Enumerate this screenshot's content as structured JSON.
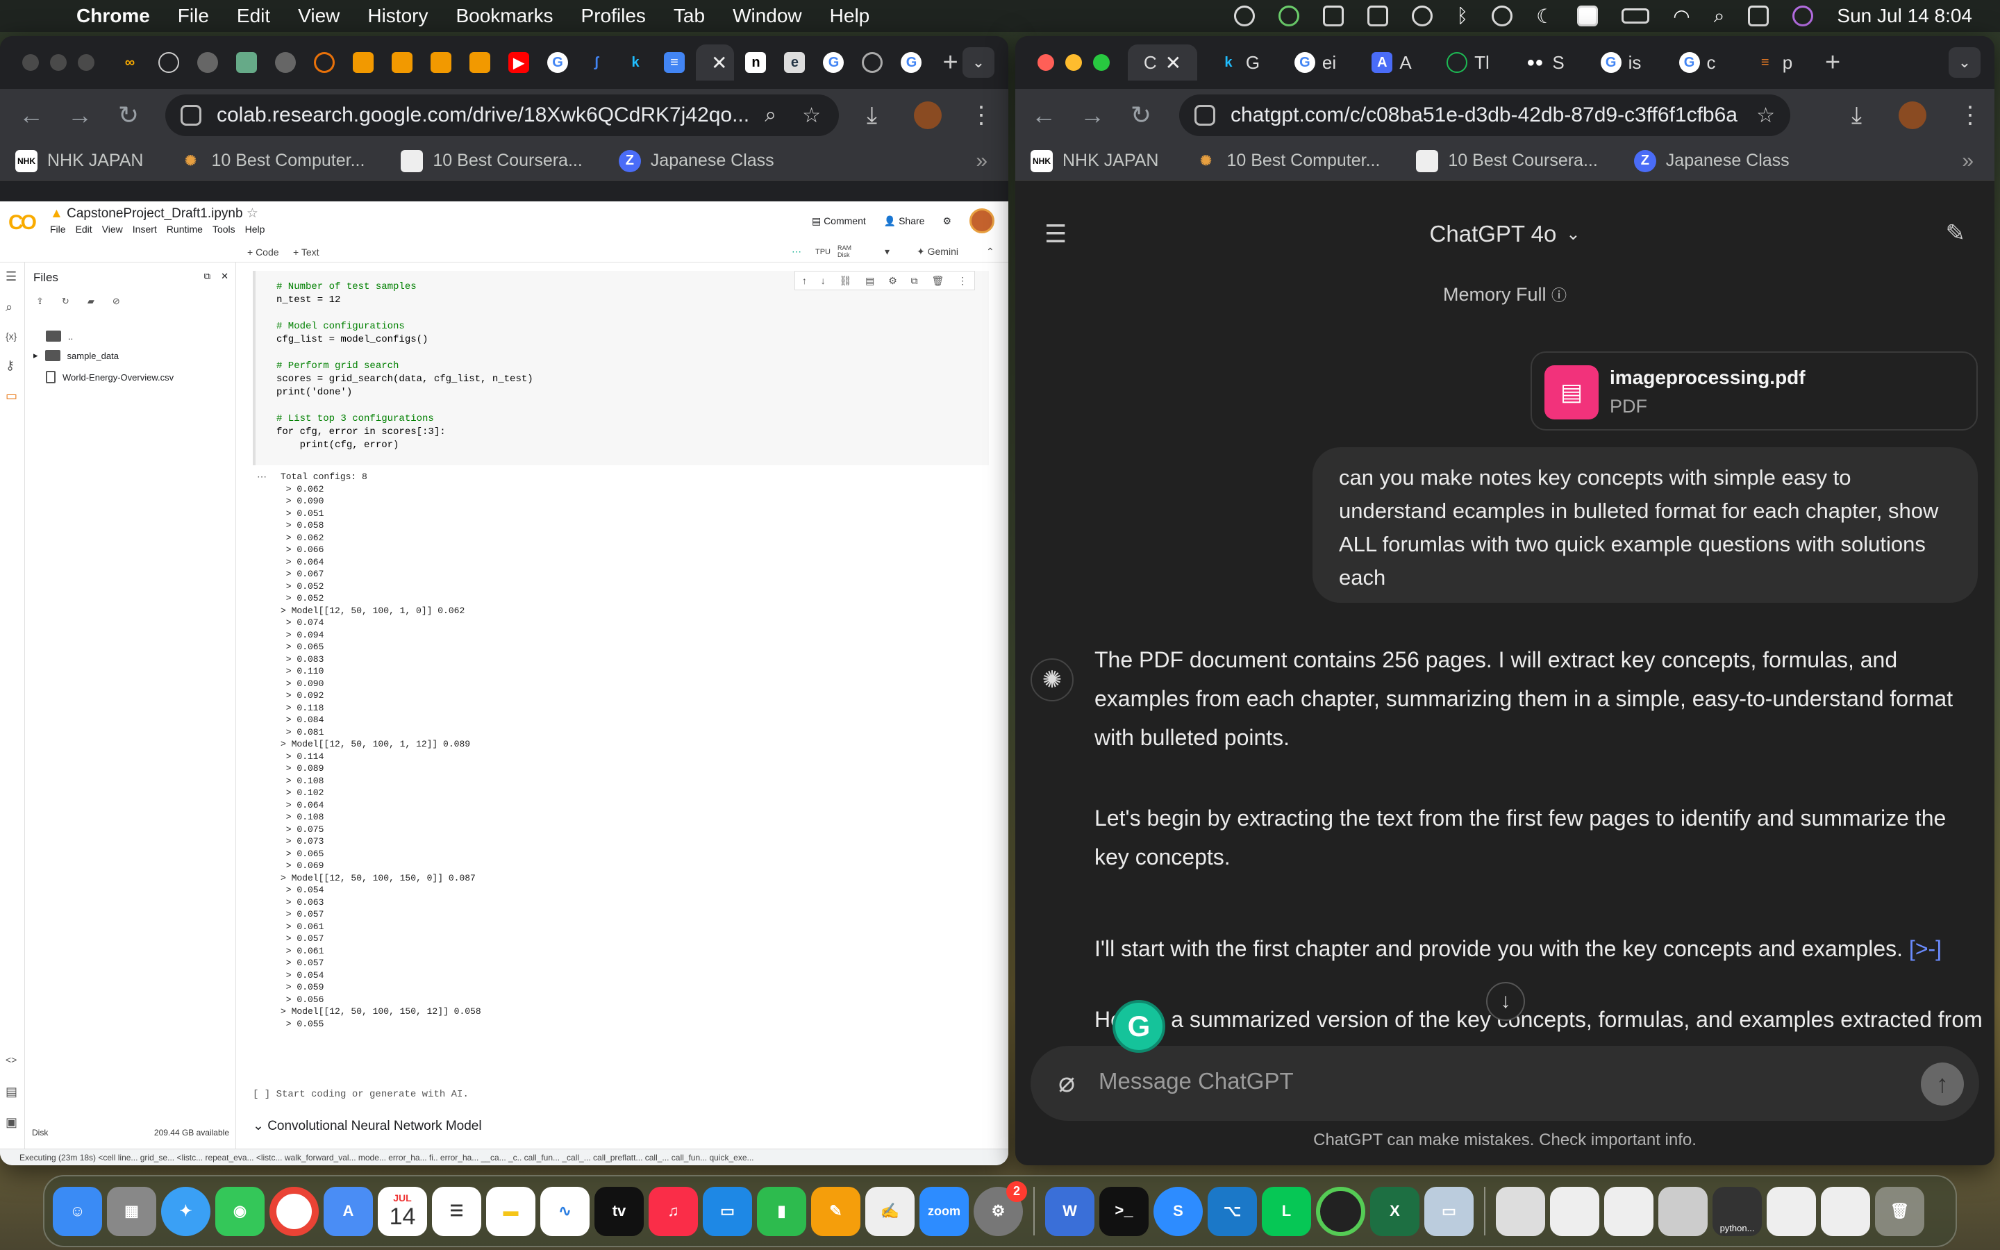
{
  "menubar": {
    "app": "Chrome",
    "items": [
      "File",
      "Edit",
      "View",
      "History",
      "Bookmarks",
      "Profiles",
      "Tab",
      "Window",
      "Help"
    ],
    "datetime": "Sun Jul 14  8:04"
  },
  "left_browser": {
    "url": "colab.research.google.com/drive/18Xwk6QCdRK7j42qo...",
    "bookmarks": [
      "NHK JAPAN",
      "10 Best Computer...",
      "10 Best Coursera...",
      "Japanese Class"
    ]
  },
  "colab": {
    "title": "CapstoneProject_Draft1.ipynb",
    "menu": [
      "File",
      "Edit",
      "View",
      "Insert",
      "Runtime",
      "Tools",
      "Help"
    ],
    "comment": "Comment",
    "share": "Share",
    "add_code": "+ Code",
    "add_text": "+ Text",
    "resource_tpu": "TPU",
    "resource_ram": "RAM",
    "resource_disk": "Disk",
    "gemini": "Gemini",
    "files_title": "Files",
    "files": [
      "..",
      "sample_data",
      "World-Energy-Overview.csv"
    ],
    "code_lines": [
      "# Number of test samples",
      "n_test = 12",
      "",
      "# Model configurations",
      "cfg_list = model_configs()",
      "",
      "# Perform grid search",
      "scores = grid_search(data, cfg_list, n_test)",
      "print('done')",
      "",
      "# List top 3 configurations",
      "for cfg, error in scores[:3]:",
      "    print(cfg, error)"
    ],
    "output": "Total configs: 8\n > 0.062\n > 0.090\n > 0.051\n > 0.058\n > 0.062\n > 0.066\n > 0.064\n > 0.067\n > 0.052\n > 0.052\n> Model[[12, 50, 100, 1, 0]] 0.062\n > 0.074\n > 0.094\n > 0.065\n > 0.083\n > 0.110\n > 0.090\n > 0.092\n > 0.118\n > 0.084\n > 0.081\n> Model[[12, 50, 100, 1, 12]] 0.089\n > 0.114\n > 0.089\n > 0.108\n > 0.102\n > 0.064\n > 0.108\n > 0.075\n > 0.073\n > 0.065\n > 0.069\n> Model[[12, 50, 100, 150, 0]] 0.087\n > 0.054\n > 0.063\n > 0.057\n > 0.061\n > 0.057\n > 0.061\n > 0.057\n > 0.054\n > 0.059\n > 0.056\n> Model[[12, 50, 100, 150, 12]] 0.058\n > 0.055",
    "empty_cell": "[ ]  Start coding or generate with AI.",
    "section_heading": "Convolutional Neural Network Model",
    "disk_label": "Disk",
    "disk_available": "209.44 GB available",
    "status": "Executing (23m 18s) <cell line...  grid_se...  <listc...  repeat_eva...  <listc...  walk_forward_val...  mode...  error_ha...  fi..  error_ha...  __ca...  _c..  call_fun...  _call_...  call_preflatt...  call_...  call_fun...  quick_exe..."
  },
  "right_browser": {
    "url": "chatgpt.com/c/c08ba51e-d3db-42db-87d9-c3ff6f1cfb6a",
    "active_tab": "C",
    "tab_labels": [
      "G",
      "ei",
      "A",
      "Tl",
      "S",
      "is",
      "c",
      "p"
    ],
    "bookmarks": [
      "NHK JAPAN",
      "10 Best Computer...",
      "10 Best Coursera...",
      "Japanese Class"
    ]
  },
  "chatgpt": {
    "model": "ChatGPT 4o",
    "memory": "Memory Full",
    "file_name": "imageprocessing.pdf",
    "file_type": "PDF",
    "user_message": "can you make notes key concepts with simple easy to understand ecamples in bulleted format for each chapter, show ALL forumlas with two quick example questions with solutions each",
    "reply": [
      "The PDF document contains 256 pages. I will extract key concepts, formulas, and examples from each chapter, summarizing them in a simple, easy-to-understand format with bulleted points.",
      "Let's begin by extracting the text from the first few pages to identify and summarize the key concepts.",
      "I'll start with the first chapter and provide you with the key concepts and examples.",
      "Here is a summarized version of the key concepts, formulas, and examples extracted from the initial pages of the document:"
    ],
    "placeholder": "Message ChatGPT",
    "disclaimer": "ChatGPT can make mistakes. Check important info."
  },
  "dock": {
    "calendar_month": "JUL",
    "calendar_day": "14",
    "settings_badge": "2",
    "zoom": "zoom",
    "python_label": "python..."
  }
}
